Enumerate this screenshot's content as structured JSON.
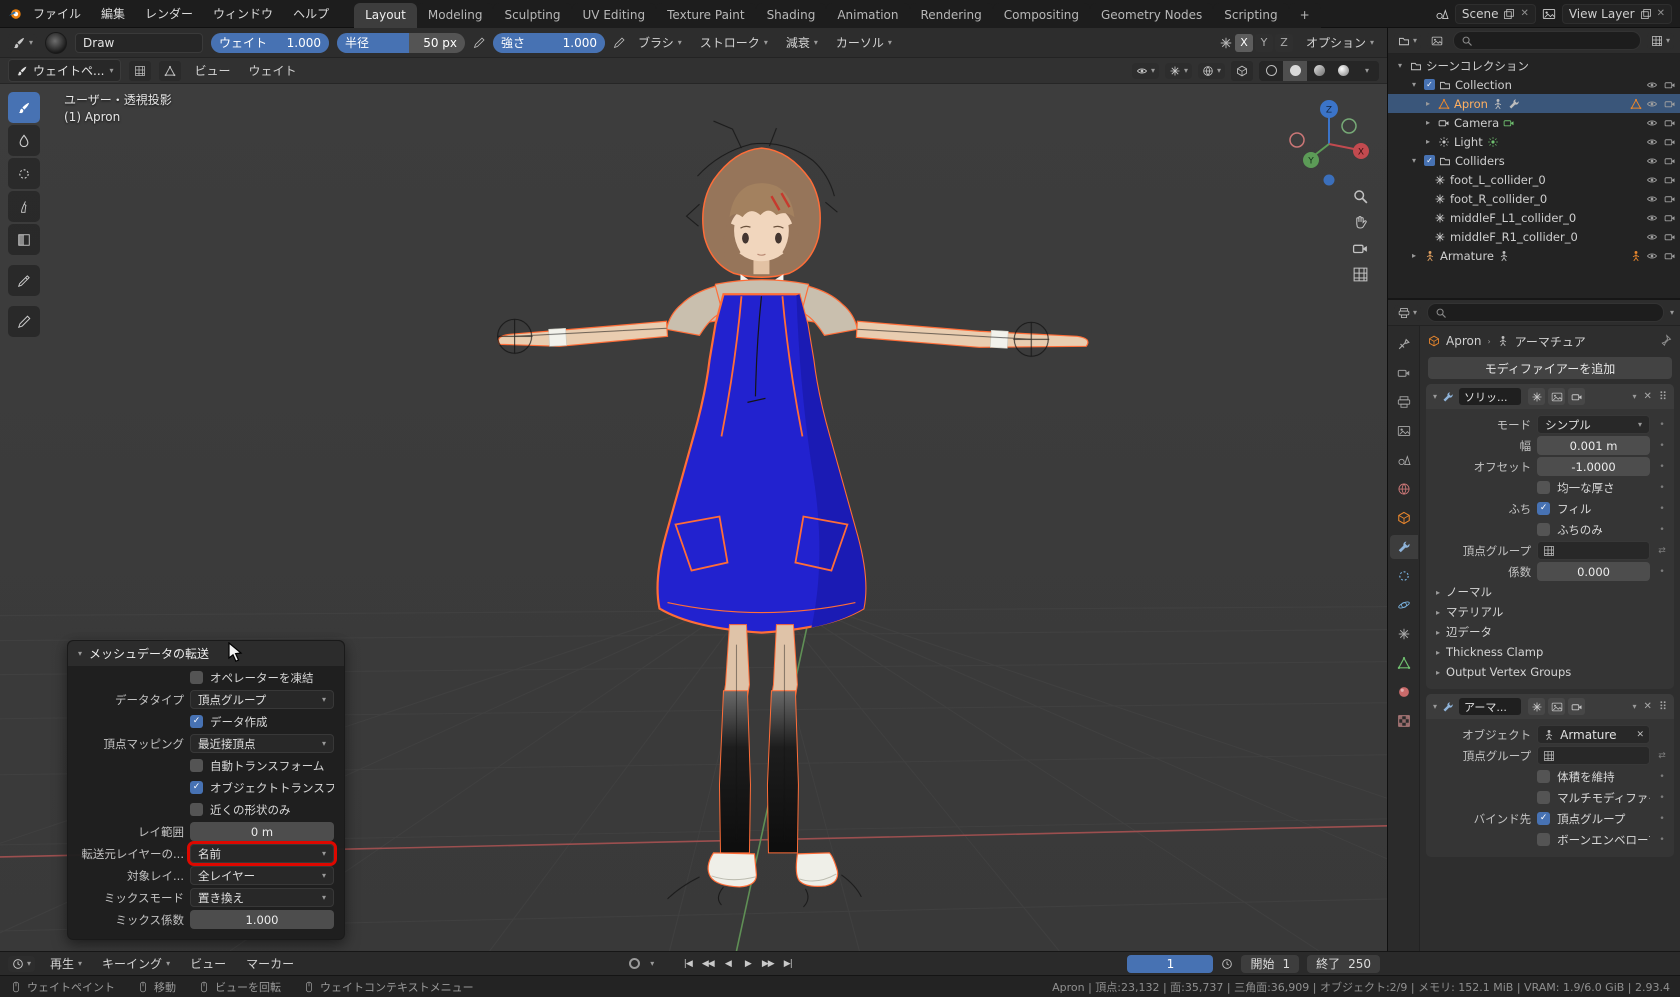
{
  "icons": {
    "dropdown": "▾",
    "expand": "▸",
    "check": "✓",
    "close": "✕",
    "swap": "⇄",
    "handle": "⠿",
    "chevron": "›",
    "plus": "+"
  },
  "topbar": {
    "menus": [
      "ファイル",
      "編集",
      "レンダー",
      "ウィンドウ",
      "ヘルプ"
    ],
    "workspaces": [
      "Layout",
      "Modeling",
      "Sculpting",
      "UV Editing",
      "Texture Paint",
      "Shading",
      "Animation",
      "Rendering",
      "Compositing",
      "Geometry Nodes",
      "Scripting"
    ],
    "active_workspace": "Layout",
    "new_workspace": "+",
    "scene_label": "Scene",
    "view_layer_label": "View Layer"
  },
  "tool_settings": {
    "brush_name": "Draw",
    "weight": {
      "label": "ウェイト",
      "value": "1.000"
    },
    "radius": {
      "label": "半径",
      "value": "50 px"
    },
    "strength": {
      "label": "強さ",
      "value": "1.000"
    },
    "menus": [
      "ブラシ",
      "ストローク",
      "減衰",
      "カーソル"
    ],
    "mirror": {
      "x": "X",
      "y": "Y",
      "z": "Z"
    },
    "options_label": "オプション"
  },
  "viewport_header": {
    "mode_selector": "ウェイトペ...",
    "menus": [
      "ビュー",
      "ウェイト"
    ]
  },
  "viewport": {
    "view_label": "ユーザー・透視投影",
    "object_label": "(1) Apron",
    "gizmo_axes": {
      "x": "X",
      "y": "Y",
      "z": "Z"
    }
  },
  "operator_panel": {
    "title": "メッシュデータの転送",
    "freeze_operator": {
      "label": "オペレーターを凍結",
      "checked": false
    },
    "data_type": {
      "label": "データタイプ",
      "value": "頂点グループ"
    },
    "create_data": {
      "label": "データ作成",
      "checked": true
    },
    "vertex_mapping": {
      "label": "頂点マッピング",
      "value": "最近接頂点"
    },
    "auto_transform": {
      "label": "自動トランスフォーム",
      "checked": false
    },
    "object_transform": {
      "label": "オブジェクトトランスフ...",
      "checked": true
    },
    "only_neighbor": {
      "label": "近くの形状のみ",
      "checked": false
    },
    "ray_radius": {
      "label": "レイ範囲",
      "value": "0 m"
    },
    "source_layers": {
      "label": "転送元レイヤーの...",
      "value": "名前"
    },
    "dest_layers": {
      "label": "対象レイ...",
      "value": "全レイヤー"
    },
    "mix_mode": {
      "label": "ミックスモード",
      "value": "置き換え"
    },
    "mix_factor": {
      "label": "ミックス係数",
      "value": "1.000"
    }
  },
  "outliner": {
    "scene_collection": "シーンコレクション",
    "rows": [
      {
        "label": "Collection"
      },
      {
        "label": "Apron"
      },
      {
        "label": "Camera"
      },
      {
        "label": "Light"
      },
      {
        "label": "Colliders"
      },
      {
        "label": "foot_L_collider_0"
      },
      {
        "label": "foot_R_collider_0"
      },
      {
        "label": "middleF_L1_collider_0"
      },
      {
        "label": "middleF_R1_collider_0"
      },
      {
        "label": "Armature"
      }
    ]
  },
  "properties": {
    "tabs": [
      "tool",
      "render",
      "output",
      "view-layer",
      "scene",
      "world",
      "object",
      "modifiers",
      "particles",
      "physics",
      "constraints",
      "object-data",
      "material",
      "texture"
    ],
    "breadcrumb": {
      "object": "Apron",
      "sub": "アーマチュア"
    },
    "add_modifier": "モディファイアーを追加",
    "solidify": {
      "name": "ソリッ...",
      "mode": {
        "label": "モード",
        "value": "シンプル"
      },
      "thickness": {
        "label": "幅",
        "value": "0.001 m"
      },
      "offset": {
        "label": "オフセット",
        "value": "-1.0000"
      },
      "even_thickness": {
        "label": "均一な厚さ",
        "checked": false
      },
      "rim_label": "ふち",
      "rim_fill": {
        "label": "フィル",
        "checked": true
      },
      "rim_only": {
        "label": "ふちのみ",
        "checked": false
      },
      "vertex_group": {
        "label": "頂点グループ"
      },
      "factor": {
        "label": "係数",
        "value": "0.000"
      },
      "sections": [
        "ノーマル",
        "マテリアル",
        "辺データ",
        "Thickness Clamp",
        "Output Vertex Groups"
      ]
    },
    "armature": {
      "name": "アーマ...",
      "object": {
        "label": "オブジェクト",
        "value": "Armature"
      },
      "vertex_group": {
        "label": "頂点グループ"
      },
      "preserve_volume": {
        "label": "体積を維持",
        "checked": false
      },
      "multi_modifier": {
        "label": "マルチモディファイア...",
        "checked": false
      },
      "bind_label": "バインド先",
      "bind_vertex_groups": {
        "label": "頂点グループ",
        "checked": true
      },
      "bind_envelopes": {
        "label": "ボーンエンベロープ",
        "checked": false
      }
    }
  },
  "timeline": {
    "menus": [
      "再生",
      "キーイング",
      "ビュー",
      "マーカー"
    ],
    "current_frame": "1",
    "start_label": "開始",
    "start_value": "1",
    "end_label": "終了",
    "end_value": "250"
  },
  "statusbar": {
    "keys": [
      "ウェイトペイント",
      "移動",
      "ビューを回転",
      "ウェイトコンテキストメニュー"
    ],
    "stats": "Apron | 頂点:23,132 | 面:35,737 | 三角面:36,909 | オブジェクト:2/9 | メモリ: 152.1 MiB | VRAM: 1.9/6.0 GiB | 2.93.4"
  },
  "colors": {
    "accent": "#4772b3",
    "selected_text": "#ffb061",
    "highlight_red": "#dd0800",
    "weight_blue": "#2222cf",
    "outline_orange": "#ff6d38"
  }
}
